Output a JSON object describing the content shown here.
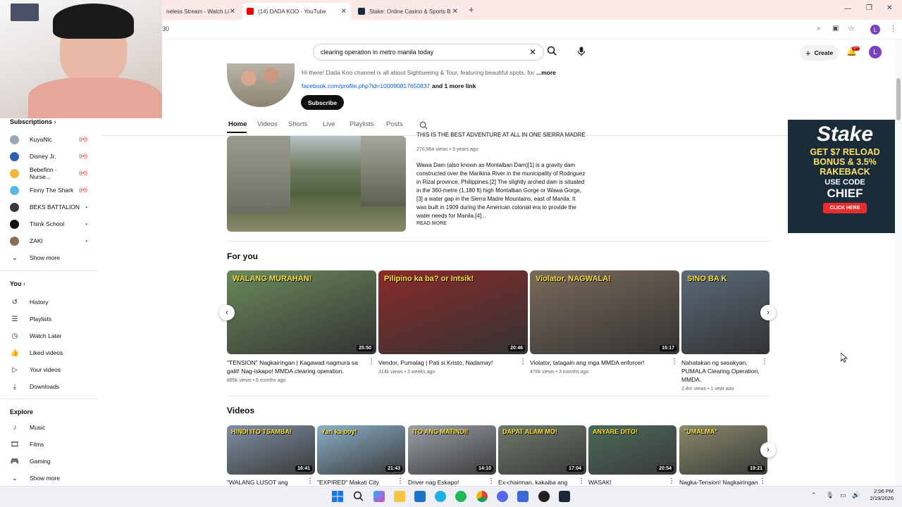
{
  "browser": {
    "tabs": [
      {
        "label": "neless Stream - Watch Li",
        "active": false
      },
      {
        "label": "(14) DADA KOO - YouTube",
        "active": true
      },
      {
        "label": "Stake: Online Casino & Sports B",
        "active": false
      }
    ],
    "address": "30",
    "profile_initial": "L"
  },
  "header": {
    "search_value": "clearing operation in metro manila today",
    "create_label": "Create",
    "notif_count": "9+",
    "avatar_initial": "L"
  },
  "channel": {
    "description": "Hi there! Dada Koo channel is all about Sightseeing & Tour, featuring beautiful spots, foo",
    "more": "...more",
    "link": "facebook.com/profile.php?id=100090817650837",
    "more_links": "and 1 more link",
    "subscribe": "Subscribe",
    "tabs": [
      "Home",
      "Videos",
      "Shorts",
      "Live",
      "Playlists",
      "Posts"
    ]
  },
  "featured": {
    "title": "THIS IS THE BEST ADVENTURE AT ALL IN ONE SIERRA MADRE ...",
    "meta": "270,964 views • 3 years ago",
    "description": "Wawa Dam (also known as Montalban Dam)[1] is a gravity dam constructed over the Marikina River in the municipality of Rodriguez in Rizal province, Philippines.[2] The slightly arched dam is situated in the 360-metre (1,180 ft) high Montalban Gorge or Wawa Gorge,[3] a water gap in the Sierra Madre Mountains, east of Manila. It was built in 1909 during the American colonial era to provide the water needs for Manila.[4]...",
    "read_more": "READ MORE"
  },
  "sidebar": {
    "subscriptions_label": "Subscriptions",
    "subscriptions": [
      {
        "name": "KuyaNic",
        "status": "live",
        "color": "#9aa6b5"
      },
      {
        "name": "Disney Jr.",
        "status": "live",
        "color": "#2f5fb3"
      },
      {
        "name": "Bebefinn - Nurse...",
        "status": "live",
        "color": "#f2b73d"
      },
      {
        "name": "Finny The Shark",
        "status": "live",
        "color": "#5ab8e8"
      },
      {
        "name": "BEKS BATTALION",
        "status": "dot",
        "color": "#3a3a3a"
      },
      {
        "name": "Think School",
        "status": "dot",
        "color": "#111111"
      },
      {
        "name": "ZAKI",
        "status": "dot",
        "color": "#8c6c5a"
      }
    ],
    "show_more": "Show more",
    "you_label": "You",
    "you_items": [
      "History",
      "Playlists",
      "Watch Later",
      "Liked videos",
      "Your videos",
      "Downloads"
    ],
    "explore_label": "Explore",
    "explore_items": [
      "Music",
      "Films",
      "Gaming"
    ],
    "show_more2": "Show more"
  },
  "for_you": {
    "heading": "For you",
    "videos": [
      {
        "title": "\"TENSION\" Nagkairingan | Kagawad nagmura sa galit! Nag-iskapo! MMDA clearing operation.",
        "meta": "885k views • 6 months ago",
        "duration": "25:50",
        "overlay": "WALANG MURAHAN!",
        "color": "#6a8a5a"
      },
      {
        "title": "Vendor, Pumalag | Pati si Kristo, Nadamay!",
        "meta": "314k views • 3 weeks ago",
        "duration": "20:46",
        "overlay": "Pilipino ka ba? or Intsik!",
        "color": "#8a2a2a"
      },
      {
        "title": "Violator, tatagain ang mga MMDA enforcer!",
        "meta": "476k views • 3 months ago",
        "duration": "15:17",
        "overlay": "Violator, NAGWALA!",
        "color": "#7a6a5a"
      },
      {
        "title": "Nahatakan ng sasakyan, PUMALA Clearing Operation, MMDA.",
        "meta": "2.4m views • 1 year ago",
        "duration": "",
        "overlay": "SINO BA K",
        "color": "#5a6a7a"
      }
    ]
  },
  "videos_section": {
    "heading": "Videos",
    "videos": [
      {
        "title": "\"WALANG LUSOT ang",
        "duration": "16:41",
        "overlay": "HINDI ITO TSAMBA!",
        "color": "#7d8fa3"
      },
      {
        "title": "\"EXPIRED\" Makati City",
        "duration": "21:43",
        "overlay": "Yari ka boy!",
        "color": "#8ab0c8"
      },
      {
        "title": "Driver nag Eskapo!",
        "duration": "14:10",
        "overlay": "ITO ANG MATINDI!",
        "color": "#9aa0a8"
      },
      {
        "title": "Ex-chairman, kakaiba ang",
        "duration": "17:04",
        "overlay": "DAPAT ALAM MO!",
        "color": "#6d7a6a"
      },
      {
        "title": "WASAK!",
        "duration": "20:54",
        "overlay": "ANYARE DITO!",
        "color": "#4a6a5a"
      },
      {
        "title": "Nagka-Tension! Nagkairingan",
        "duration": "19:21",
        "overlay": "\"UMALMA\"",
        "color": "#8a8a6a"
      }
    ]
  },
  "ad": {
    "brand": "Stake",
    "line1": "GET $7 RELOAD",
    "line2": "BONUS & 3.5%",
    "line3": "RAKEBACK",
    "line4": "USE CODE",
    "code": "CHIEF",
    "cta": "CLICK HERE"
  },
  "taskbar": {
    "time": "2:06 PM",
    "date": "2/19/2026"
  }
}
